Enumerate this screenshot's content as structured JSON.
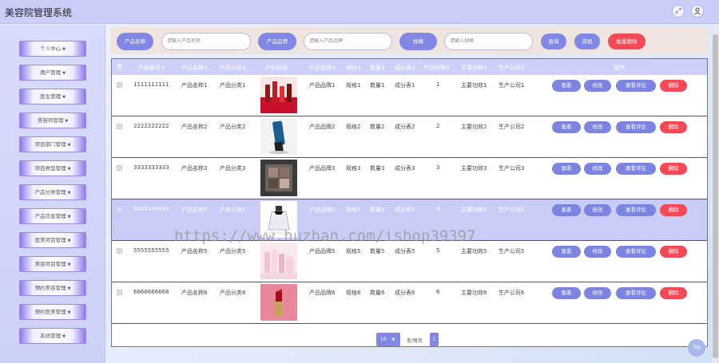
{
  "header": {
    "title": "美容院管理系统",
    "fullscreen_icon": "fullscreen-icon",
    "user_icon": "user-icon"
  },
  "sidebar": {
    "items": [
      {
        "label": "个人中心"
      },
      {
        "label": "用户管理"
      },
      {
        "label": "医生管理"
      },
      {
        "label": "美容师管理"
      },
      {
        "label": "项目部门管理"
      },
      {
        "label": "项目类型管理"
      },
      {
        "label": "产品分类管理"
      },
      {
        "label": "产品信息管理"
      },
      {
        "label": "医美项目管理"
      },
      {
        "label": "美容项目管理"
      },
      {
        "label": "预约美容管理"
      },
      {
        "label": "预约医美管理"
      },
      {
        "label": "系统管理"
      }
    ]
  },
  "search": {
    "name_label": "产品名称",
    "name_placeholder": "请输入产品名称",
    "brand_label": "产品品牌",
    "brand_placeholder": "请输入产品品牌",
    "spec_label": "规格",
    "spec_placeholder": "请输入规格",
    "query_button": "查询",
    "add_button": "添加",
    "batch_delete_button": "批量删除"
  },
  "table": {
    "headers": {
      "code": "产品编号",
      "name": "产品名称",
      "category": "产品分类",
      "cover": "产品封面",
      "brand": "产品品牌",
      "spec": "规格",
      "qty": "数量",
      "ingredient": "成分表",
      "price": "产品价格",
      "effect": "主要功效",
      "maker": "生产公司",
      "ops": "操作"
    },
    "sort_mark": "⇕",
    "actions": {
      "view": "查看",
      "edit": "修改",
      "comment": "查看评论",
      "delete": "删除"
    },
    "rows": [
      {
        "code": "1111111111",
        "name": "产品名称1",
        "category": "产品分类1",
        "brand": "产品品牌1",
        "spec": "规格1",
        "qty": "数量1",
        "ingredient": "成分表1",
        "price": "1",
        "effect": "主要功效1",
        "maker": "生产公司1",
        "thumb": "lipstick-set"
      },
      {
        "code": "2222222222",
        "name": "产品名称2",
        "category": "产品分类2",
        "brand": "产品品牌2",
        "spec": "规格2",
        "qty": "数量2",
        "ingredient": "成分表2",
        "price": "2",
        "effect": "主要功效2",
        "maker": "生产公司2",
        "thumb": "serum-tube"
      },
      {
        "code": "3333333333",
        "name": "产品名称3",
        "category": "产品分类3",
        "brand": "产品品牌3",
        "spec": "规格3",
        "qty": "数量3",
        "ingredient": "成分表3",
        "price": "3",
        "effect": "主要功效3",
        "maker": "生产公司3",
        "thumb": "eyeshadow"
      },
      {
        "code": "4444444444",
        "name": "产品名称4",
        "category": "产品分类4",
        "brand": "产品品牌4",
        "spec": "规格4",
        "qty": "数量4",
        "ingredient": "成分表4",
        "price": "4",
        "effect": "主要功效4",
        "maker": "生产公司4",
        "thumb": "perfume"
      },
      {
        "code": "5555555555",
        "name": "产品名称5",
        "category": "产品分类5",
        "brand": "产品品牌5",
        "spec": "规格5",
        "qty": "数量5",
        "ingredient": "成分表5",
        "price": "5",
        "effect": "主要功效5",
        "maker": "生产公司5",
        "thumb": "skincare-set"
      },
      {
        "code": "6666666666",
        "name": "产品名称6",
        "category": "产品分类6",
        "brand": "产品品牌6",
        "spec": "规格6",
        "qty": "数量6",
        "ingredient": "成分表6",
        "price": "6",
        "effect": "主要功效6",
        "maker": "生产公司6",
        "thumb": "lipstick-red"
      }
    ]
  },
  "pagination": {
    "page_size": "10",
    "page_size_label": "条/每页",
    "current_page": "1"
  },
  "top_button": "Top",
  "watermark": "https://www.huzhan.com/ishop39397",
  "colors": {
    "accent": "#8087e4",
    "danger": "#f44a58",
    "header_bg": "#c9cdf7"
  }
}
